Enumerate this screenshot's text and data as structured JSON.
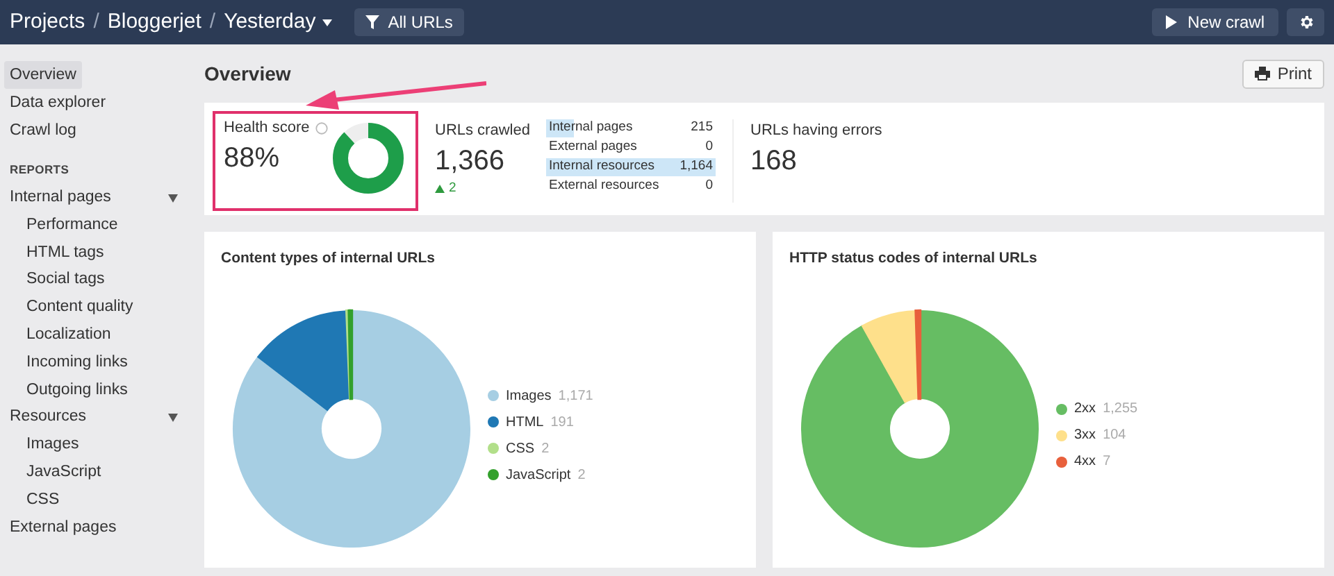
{
  "header": {
    "breadcrumbs": [
      {
        "kind": "link",
        "text": "Projects"
      },
      {
        "kind": "separator",
        "text": "/"
      },
      {
        "kind": "link",
        "text": "Bloggerjet"
      },
      {
        "kind": "separator",
        "text": "/"
      },
      {
        "kind": "dropdown",
        "text": "Yesterday"
      }
    ],
    "filter_button": "All URLs",
    "new_crawl_button": "New crawl"
  },
  "sidebar": {
    "items": [
      {
        "label": "Overview",
        "selected": true
      },
      {
        "label": "Data explorer",
        "selected": false
      },
      {
        "label": "Crawl log",
        "selected": false
      }
    ],
    "section_heading": "REPORTS",
    "reports": [
      {
        "label": "Internal pages",
        "expanded": true,
        "children": [
          {
            "label": "Performance"
          },
          {
            "label": "HTML tags"
          },
          {
            "label": "Social tags"
          },
          {
            "label": "Content quality"
          },
          {
            "label": "Localization"
          },
          {
            "label": "Incoming links"
          },
          {
            "label": "Outgoing links"
          }
        ]
      },
      {
        "label": "Resources",
        "expanded": true,
        "children": [
          {
            "label": "Images"
          },
          {
            "label": "JavaScript"
          },
          {
            "label": "CSS"
          }
        ]
      },
      {
        "label": "External pages"
      }
    ]
  },
  "page_title": "Overview",
  "print_button": "Print",
  "stats": {
    "health_score": {
      "label": "Health score",
      "value": "88%",
      "level": 0.88,
      "highlighted": true
    },
    "urls_crawled": {
      "label": "URLs crawled",
      "value": "1,366",
      "change": "2"
    },
    "breakdown": [
      {
        "label": "Internal pages",
        "value": "215",
        "level": 0.16
      },
      {
        "label": "External pages",
        "value": "0",
        "level": 0
      },
      {
        "label": "Internal resources",
        "value": "1,164",
        "level": 1
      },
      {
        "label": "External resources",
        "value": "0",
        "level": 0
      }
    ],
    "errors": {
      "label": "URLs having errors",
      "value": "168"
    }
  },
  "charts": [
    {
      "title": "Content types of internal URLs",
      "chart_data": {
        "type": "donut",
        "categories": [
          "Images",
          "HTML",
          "CSS",
          "JavaScript"
        ],
        "values": [
          1171,
          191,
          2,
          2
        ],
        "legend": true,
        "colors": [
          "#a6cee3",
          "#1f78b4",
          "#b2df8a",
          "#33a02c"
        ],
        "value_labels": [
          "1,171",
          "191",
          "2",
          "2"
        ]
      }
    },
    {
      "title": "HTTP status codes of internal URLs",
      "chart_data": {
        "type": "donut",
        "categories": [
          "2xx",
          "3xx",
          "4xx"
        ],
        "values": [
          1255,
          104,
          7
        ],
        "legend": true,
        "colors": [
          "#66bd63",
          "#fee08b",
          "#e8603c"
        ],
        "value_labels": [
          "1,255",
          "104",
          "7"
        ]
      }
    }
  ]
}
